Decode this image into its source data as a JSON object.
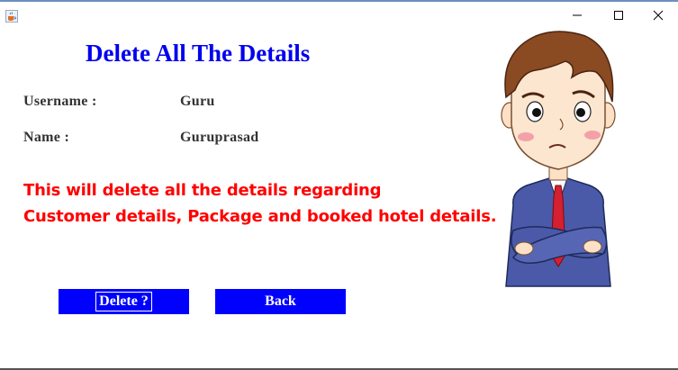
{
  "window": {
    "minimize_symbol": "—",
    "maximize_symbol": "☐",
    "close_symbol": "✕"
  },
  "heading": "Delete All The Details",
  "fields": {
    "username_label": "Username :",
    "username_value": "Guru",
    "name_label": "Name :",
    "name_value": "Guruprasad"
  },
  "warning": {
    "line1": "This will delete all the details regarding",
    "line2": "Customer details, Package and booked hotel details."
  },
  "buttons": {
    "delete_label": "Delete ?",
    "back_label": "Back"
  },
  "colors": {
    "heading": "#0000ee",
    "warning": "#ff0000",
    "button_bg": "#0000ff",
    "button_text": "#ffffff"
  },
  "icons": {
    "app": "java-cup-icon",
    "illustration": "confused-boy-illustration"
  }
}
